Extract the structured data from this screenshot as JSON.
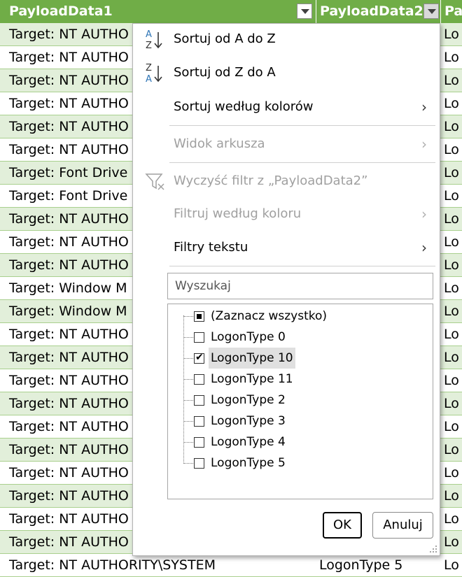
{
  "sheet": {
    "headers": [
      {
        "label": "PayloadData1"
      },
      {
        "label": "PayloadData2"
      },
      {
        "label": "Pa"
      }
    ],
    "rows": [
      {
        "c1": "Target: NT AUTHO",
        "c2": "",
        "c3": "Lo"
      },
      {
        "c1": "Target: NT AUTHO",
        "c2": "",
        "c3": "Lo"
      },
      {
        "c1": "Target: NT AUTHO",
        "c2": "",
        "c3": "Lo"
      },
      {
        "c1": "Target: NT AUTHO",
        "c2": "",
        "c3": "Lo"
      },
      {
        "c1": "Target: NT AUTHO",
        "c2": "",
        "c3": "Lo"
      },
      {
        "c1": "Target: NT AUTHO",
        "c2": "",
        "c3": "Lo"
      },
      {
        "c1": "Target: Font Drive",
        "c2": "",
        "c3": "Lo"
      },
      {
        "c1": "Target: Font Drive",
        "c2": "",
        "c3": "Lo"
      },
      {
        "c1": "Target: NT AUTHO",
        "c2": "",
        "c3": "Lo"
      },
      {
        "c1": "Target: NT AUTHO",
        "c2": "",
        "c3": "Lo"
      },
      {
        "c1": "Target: NT AUTHO",
        "c2": "",
        "c3": "Lo"
      },
      {
        "c1": "Target: Window M",
        "c2": "",
        "c3": "Lo"
      },
      {
        "c1": "Target: Window M",
        "c2": "",
        "c3": "Lo"
      },
      {
        "c1": "Target: NT AUTHO",
        "c2": "",
        "c3": "Lo"
      },
      {
        "c1": "Target: NT AUTHO",
        "c2": "",
        "c3": "Lo"
      },
      {
        "c1": "Target: NT AUTHO",
        "c2": "",
        "c3": "Lo"
      },
      {
        "c1": "Target: NT AUTHO",
        "c2": "",
        "c3": "Lo"
      },
      {
        "c1": "Target: NT AUTHO",
        "c2": "",
        "c3": "Lo"
      },
      {
        "c1": "Target: NT AUTHO",
        "c2": "",
        "c3": "Lo"
      },
      {
        "c1": "Target: NT AUTHO",
        "c2": "",
        "c3": "Lo"
      },
      {
        "c1": "Target: NT AUTHO",
        "c2": "",
        "c3": "Lo"
      },
      {
        "c1": "Target: NT AUTHO",
        "c2": "",
        "c3": "Lo"
      },
      {
        "c1": "Target: NT AUTHO",
        "c2": "",
        "c3": "Lo"
      },
      {
        "c1": "Target: NT AUTHORITY\\SYSTEM",
        "c2": "LogonType 5",
        "c3": "Lo"
      }
    ]
  },
  "menu": {
    "sort_az": "Sortuj od A do Z",
    "sort_za": "Sortuj od Z do A",
    "sort_color": "Sortuj według kolorów",
    "sheet_view": "Widok arkusza",
    "clear_filter": "Wyczyść filtr z „PayloadData2”",
    "filter_color": "Filtruj według koloru",
    "text_filters": "Filtry tekstu",
    "search_placeholder": "Wyszukaj",
    "items": [
      {
        "label": "(Zaznacz wszystko)",
        "state": "partial"
      },
      {
        "label": "LogonType 0",
        "state": "unchecked"
      },
      {
        "label": "LogonType 10",
        "state": "checked"
      },
      {
        "label": "LogonType 11",
        "state": "unchecked"
      },
      {
        "label": "LogonType 2",
        "state": "unchecked"
      },
      {
        "label": "LogonType 3",
        "state": "unchecked"
      },
      {
        "label": "LogonType 4",
        "state": "unchecked"
      },
      {
        "label": "LogonType 5",
        "state": "unchecked"
      }
    ],
    "ok": "OK",
    "cancel": "Anuluj"
  },
  "colors": {
    "header_green": "#70ad47",
    "band_green": "#e2efda",
    "sort_icon_blue": "#2e75b6"
  }
}
